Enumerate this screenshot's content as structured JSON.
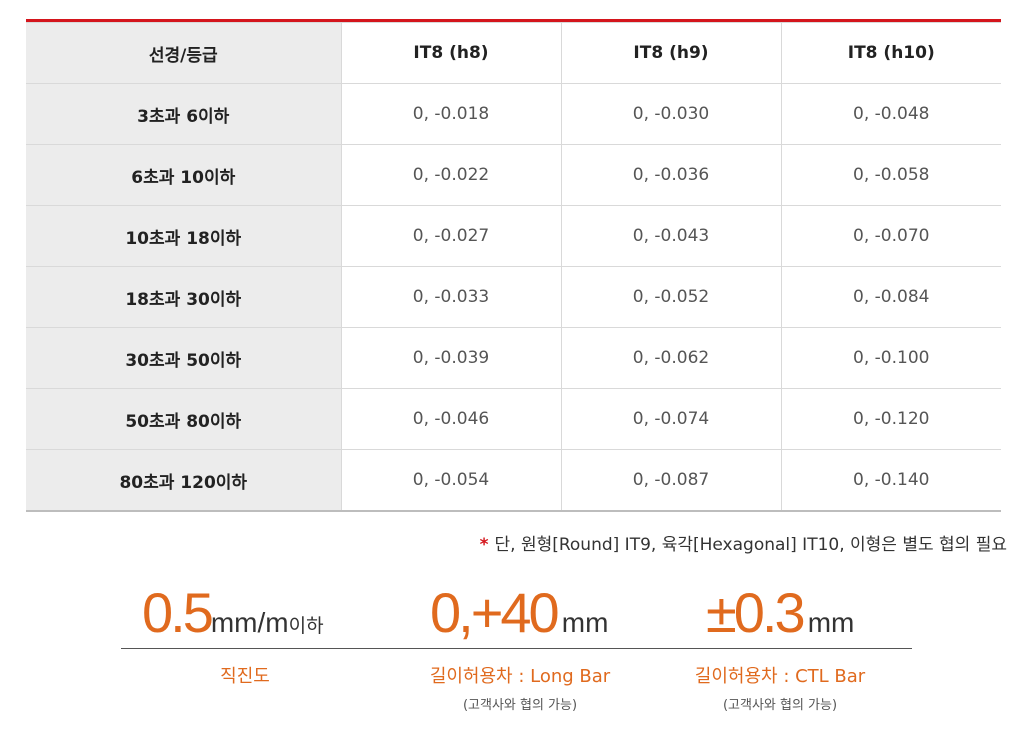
{
  "table": {
    "headers": [
      "선경/등급",
      "IT8 (h8)",
      "IT8 (h9)",
      "IT8 (h10)"
    ],
    "rows": [
      [
        "3초과 6이하",
        "0, -0.018",
        "0, -0.030",
        "0, -0.048"
      ],
      [
        "6초과 10이하",
        "0, -0.022",
        "0, -0.036",
        "0, -0.058"
      ],
      [
        "10초과 18이하",
        "0, -0.027",
        "0, -0.043",
        "0, -0.070"
      ],
      [
        "18초과 30이하",
        "0, -0.033",
        "0, -0.052",
        "0, -0.084"
      ],
      [
        "30초과 50이하",
        "0, -0.039",
        "0, -0.062",
        "0, -0.100"
      ],
      [
        "50초과 80이하",
        "0, -0.046",
        "0, -0.074",
        "0, -0.120"
      ],
      [
        "80초과 120이하",
        "0, -0.054",
        "0, -0.087",
        "0, -0.140"
      ]
    ]
  },
  "note": {
    "marker": "*",
    "text": "단, 원형[Round] IT9, 육각[Hexagonal] IT10, 이형은 별도 협의 필요"
  },
  "specs": {
    "straightness": {
      "value": "0.5",
      "unit": "mm/m",
      "suffix": "이하",
      "label": "직진도",
      "sub": ""
    },
    "long_bar": {
      "value": "0,+40",
      "unit": "mm",
      "suffix": "",
      "label": "길이허용차 : Long Bar",
      "sub": "(고객사와 협의 가능)"
    },
    "ctl_bar": {
      "value": "±0.3",
      "unit": "mm",
      "suffix": "",
      "label": "길이허용차 : CTL Bar",
      "sub": "(고객사와 협의 가능)"
    }
  },
  "colors": {
    "accent_red": "#d4151c",
    "accent_orange": "#e06a1e",
    "header_gray": "#ececec"
  }
}
